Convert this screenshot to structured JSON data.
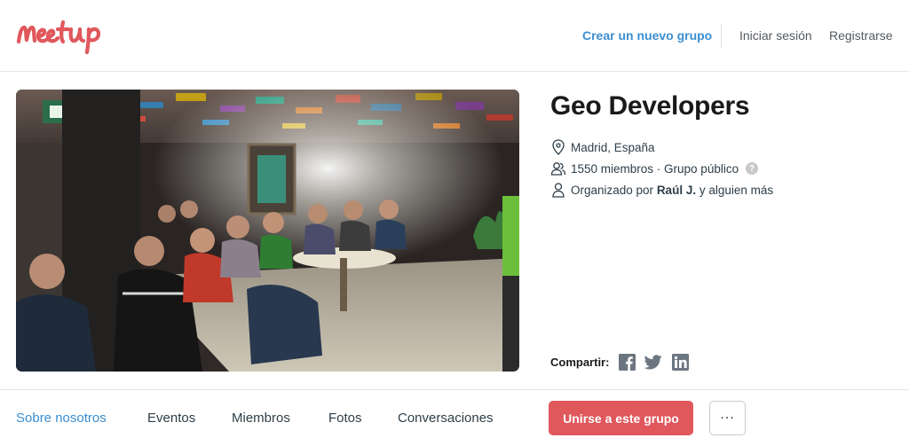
{
  "header": {
    "logo_text": "Meetup",
    "create_group": "Crear un nuevo grupo",
    "login": "Iniciar sesión",
    "signup": "Registrarse"
  },
  "group": {
    "title": "Geo Developers",
    "location": "Madrid, España",
    "members": "1550 miembros · Grupo público",
    "help_icon_text": "?",
    "organizer_prefix": "Organizado por ",
    "organizer_name": "Raúl J.",
    "organizer_suffix": " y alguien más",
    "hero_icons": [
      "location-pin-icon",
      "members-icon",
      "organizer-icon"
    ]
  },
  "share": {
    "label": "Compartir:",
    "networks": [
      "facebook-icon",
      "twitter-icon",
      "linkedin-icon"
    ]
  },
  "tabs": {
    "about": "Sobre nosotros",
    "events": "Eventos",
    "members": "Miembros",
    "photos": "Fotos",
    "discussions": "Conversaciones",
    "active": "about"
  },
  "actions": {
    "join": "Unirse a este grupo",
    "more": "···"
  },
  "colors": {
    "brand": "#e0585c",
    "link": "#3b8ed0",
    "text": "#2e3e48"
  }
}
